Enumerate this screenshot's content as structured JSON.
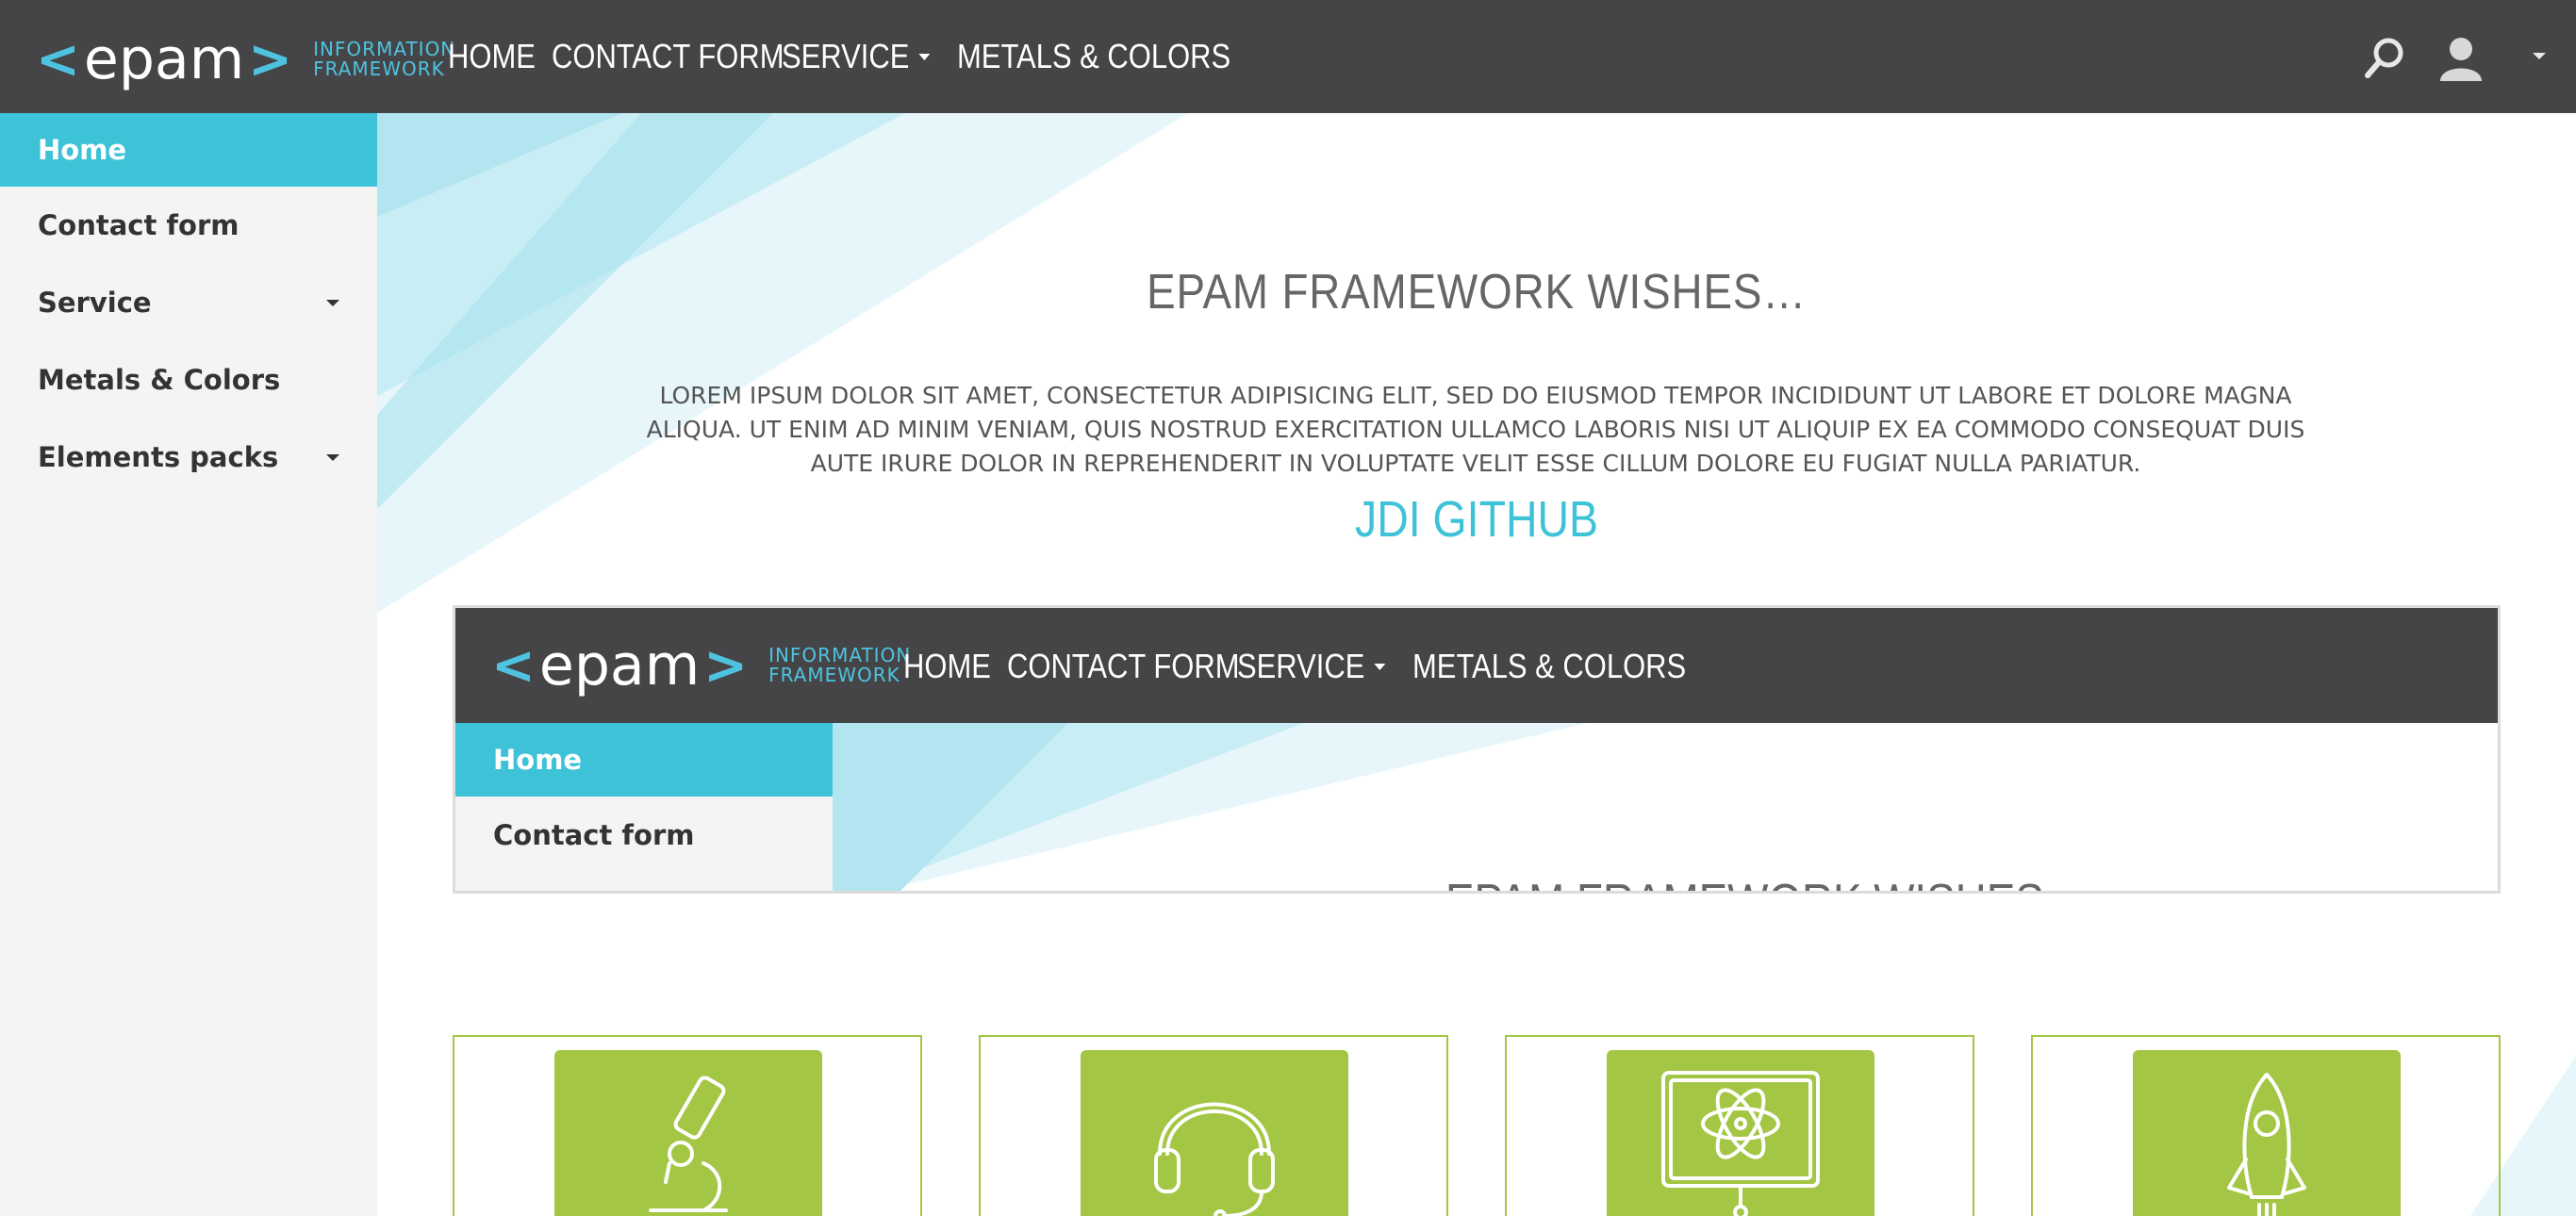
{
  "logo": {
    "left_bracket": "<",
    "word": "epam",
    "right_bracket": ">",
    "tagline_line1": "INFORMATION",
    "tagline_line2": "FRAMEWORK"
  },
  "top_menu": [
    {
      "label": "HOME"
    },
    {
      "label": "CONTACT FORM"
    },
    {
      "label": "SERVICE",
      "has_dropdown": true
    },
    {
      "label": "METALS & COLORS"
    }
  ],
  "sidebar": {
    "items": [
      {
        "label": "Home",
        "active": true
      },
      {
        "label": "Contact form"
      },
      {
        "label": "Service",
        "has_dropdown": true
      },
      {
        "label": "Metals & Colors"
      },
      {
        "label": "Elements packs",
        "has_dropdown": true
      }
    ]
  },
  "main": {
    "title": "EPAM FRAMEWORK WISHES…",
    "lorem": "LOREM IPSUM DOLOR SIT AMET, CONSECTETUR ADIPISICING ELIT, SED DO EIUSMOD TEMPOR INCIDIDUNT UT LABORE ET DOLORE MAGNA ALIQUA. UT ENIM AD MINIM VENIAM, QUIS NOSTRUD EXERCITATION ULLAMCO LABORIS NISI UT ALIQUIP EX EA COMMODO CONSEQUAT DUIS AUTE IRURE DOLOR IN REPREHENDERIT IN VOLUPTATE VELIT ESSE CILLUM DOLORE EU FUGIAT NULLA PARIATUR.",
    "link": "JDI GITHUB"
  },
  "frame": {
    "logo_word": "epam",
    "tagline_line1": "INFORMATION",
    "tagline_line2": "FRAMEWORK",
    "top_menu": [
      {
        "label": "HOME"
      },
      {
        "label": "CONTACT FORM"
      },
      {
        "label": "SERVICE"
      },
      {
        "label": "METALS & COLORS"
      }
    ],
    "sidebar": [
      {
        "label": "Home"
      },
      {
        "label": "Contact form"
      }
    ],
    "title": "EPAM FRAMEWORK WISHES…"
  },
  "benefits": [
    {
      "icon": "microscope-icon"
    },
    {
      "icon": "headset-icon"
    },
    {
      "icon": "monitor-atom-icon"
    },
    {
      "icon": "rocket-icon"
    }
  ],
  "colors": {
    "header_bg": "#454547",
    "accent_blue": "#3ec2d8",
    "accent_green": "#a3c644",
    "sidebar_bg": "#f4f4f4"
  }
}
